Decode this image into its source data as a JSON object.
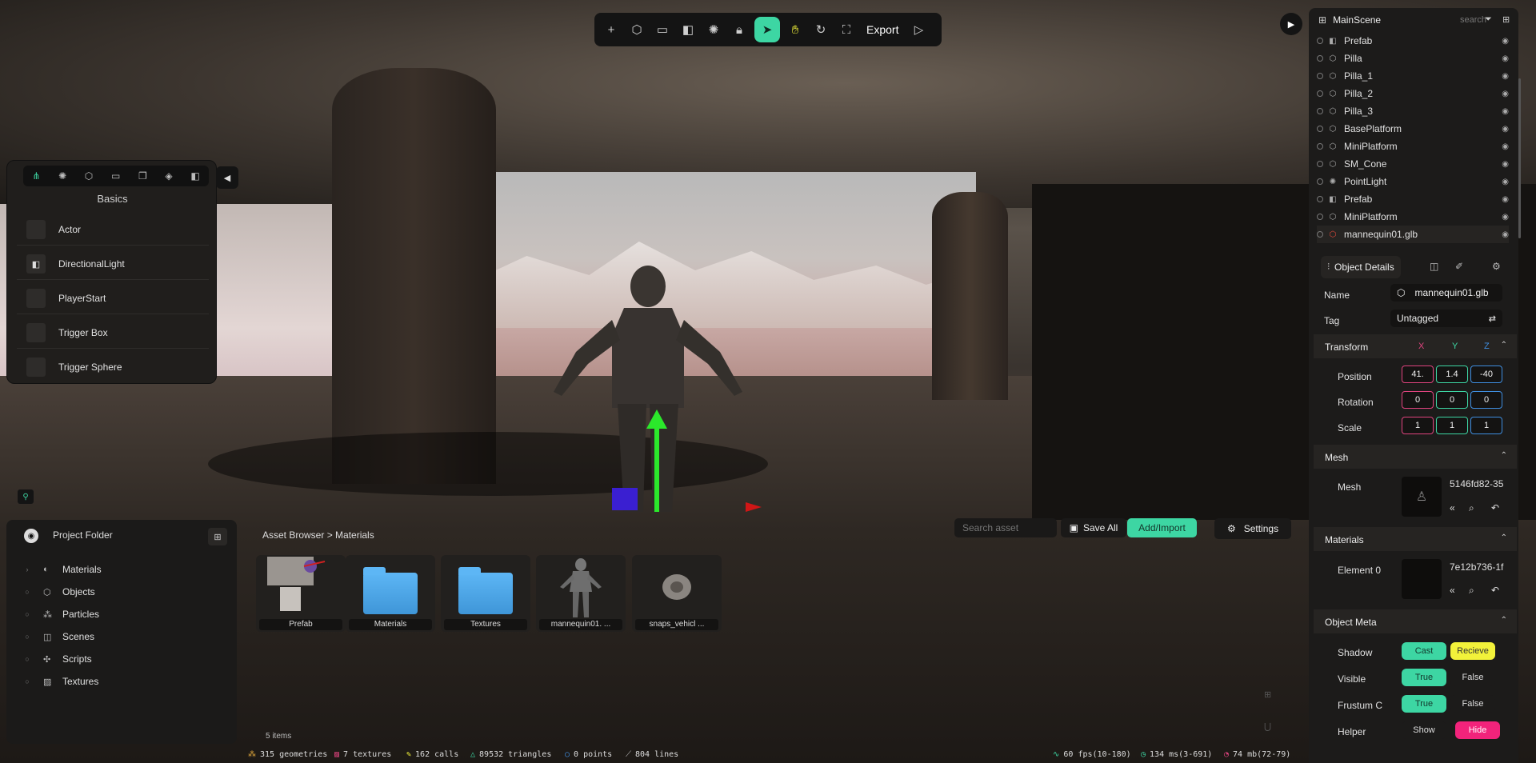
{
  "toolbar": {
    "export_label": "Export"
  },
  "actors": {
    "title": "Basics",
    "items": [
      {
        "label": "Actor"
      },
      {
        "label": "DirectionalLight"
      },
      {
        "label": "PlayerStart"
      },
      {
        "label": "Trigger Box"
      },
      {
        "label": "Trigger Sphere"
      }
    ]
  },
  "project": {
    "title": "Project Folder",
    "folders": [
      {
        "label": "Materials"
      },
      {
        "label": "Objects"
      },
      {
        "label": "Particles"
      },
      {
        "label": "Scenes"
      },
      {
        "label": "Scripts"
      },
      {
        "label": "Textures"
      }
    ]
  },
  "assets": {
    "breadcrumb": "Asset Browser > Materials",
    "search_placeholder": "Search asset",
    "save_all": "Save All",
    "add_import": "Add/Import",
    "settings": "Settings",
    "count": "5 items",
    "items": [
      {
        "label": "Prefab"
      },
      {
        "label": "Materials"
      },
      {
        "label": "Textures"
      },
      {
        "label": "mannequin01. ..."
      },
      {
        "label": "snaps_vehicl ..."
      }
    ]
  },
  "status": {
    "geometries": "315 geometries",
    "textures": "7 textures",
    "calls": "162 calls",
    "triangles": "89532 triangles",
    "points": "0 points",
    "lines": "804 lines",
    "fps": "60 fps(10-180)",
    "ms": "134 ms(3-691)",
    "mb": "74 mb(72-79)"
  },
  "scene": {
    "name": "MainScene",
    "search_placeholder": "search",
    "tree": [
      {
        "label": "Prefab",
        "icon": "prefab"
      },
      {
        "label": "Pilla",
        "icon": "mesh"
      },
      {
        "label": "Pilla_1",
        "icon": "mesh"
      },
      {
        "label": "Pilla_2",
        "icon": "mesh"
      },
      {
        "label": "Pilla_3",
        "icon": "mesh"
      },
      {
        "label": "BasePlatform",
        "icon": "mesh"
      },
      {
        "label": "MiniPlatform",
        "icon": "mesh"
      },
      {
        "label": "SM_Cone",
        "icon": "mesh"
      },
      {
        "label": "PointLight",
        "icon": "light"
      },
      {
        "label": "Prefab",
        "icon": "prefab"
      },
      {
        "label": "MiniPlatform",
        "icon": "mesh"
      },
      {
        "label": "mannequin01.glb",
        "icon": "mesh",
        "selected": true
      }
    ]
  },
  "details": {
    "tab_label": "Object Details",
    "name_label": "Name",
    "name_value": "mannequin01.glb",
    "tag_label": "Tag",
    "tag_value": "Untagged",
    "transform": {
      "title": "Transform",
      "axis_x": "X",
      "axis_y": "Y",
      "axis_z": "Z",
      "position_label": "Position",
      "rotation_label": "Rotation",
      "scale_label": "Scale",
      "position": [
        "41.",
        "1.4",
        "-40"
      ],
      "rotation": [
        "0",
        "0",
        "0"
      ],
      "scale": [
        "1",
        "1",
        "1"
      ]
    },
    "mesh": {
      "title": "Mesh",
      "label": "Mesh",
      "value": "5146fd82-35"
    },
    "materials": {
      "title": "Materials",
      "label": "Element 0",
      "value": "7e12b736-1f"
    },
    "meta": {
      "title": "Object Meta",
      "shadow_label": "Shadow",
      "shadow_cast": "Cast",
      "shadow_recieve": "Recieve",
      "visible_label": "Visible",
      "frustum_label": "Frustum C",
      "helper_label": "Helper",
      "true_label": "True",
      "false_label": "False",
      "show_label": "Show",
      "hide_label": "Hide"
    }
  },
  "colors": {
    "accent": "#3dd6a3",
    "axis_x": "#e0447f",
    "axis_y": "#3dd6a3",
    "axis_z": "#3f8ee0",
    "yellow": "#f2f23a",
    "pink": "#f2237b"
  }
}
